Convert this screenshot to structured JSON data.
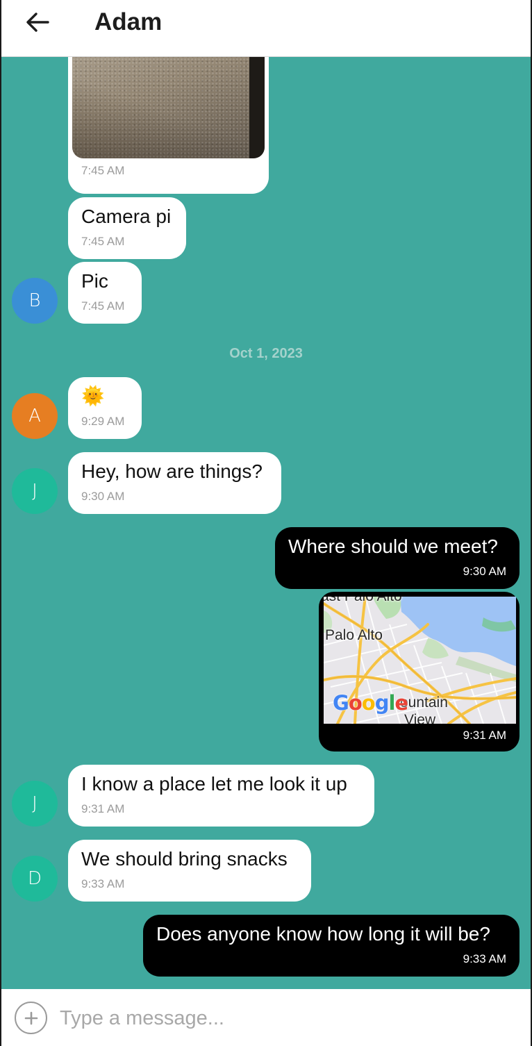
{
  "header": {
    "back_icon": "arrow-left-icon",
    "title": "Adam"
  },
  "colors": {
    "background": "#40a99e",
    "incoming_bubble": "#ffffff",
    "outgoing_bubble": "#000000",
    "avatar_blue": "#3a8fd6",
    "avatar_orange": "#e67e22",
    "avatar_teal": "#1fba9a"
  },
  "messages": [
    {
      "sender": "incoming",
      "type": "image",
      "time": "7:45 AM"
    },
    {
      "sender": "incoming",
      "type": "text",
      "text": "Camera pi",
      "time": "7:45 AM"
    },
    {
      "sender": "incoming",
      "type": "text",
      "avatar": "B",
      "text": "Pic",
      "time": "7:45 AM"
    },
    {
      "date_separator": "Oct 1, 2023"
    },
    {
      "sender": "incoming",
      "type": "emoji",
      "avatar": "A",
      "emoji": "🌞",
      "time": "9:29 AM"
    },
    {
      "sender": "incoming",
      "type": "text",
      "avatar": "J",
      "text": "Hey, how are things?",
      "time": "9:30 AM"
    },
    {
      "sender": "outgoing",
      "type": "text",
      "text": "Where should we meet?",
      "time": "9:30 AM"
    },
    {
      "sender": "outgoing",
      "type": "map",
      "labels": [
        "ast Palo Alto",
        "Palo Alto",
        "ountain",
        "View"
      ],
      "logo": "Google",
      "time": "9:31 AM"
    },
    {
      "sender": "incoming",
      "type": "text",
      "avatar": "J",
      "text": "I know a place let me look it up",
      "time": "9:31 AM"
    },
    {
      "sender": "incoming",
      "type": "text",
      "avatar": "D",
      "text": "We should bring snacks",
      "time": "9:33 AM"
    },
    {
      "sender": "outgoing",
      "type": "text",
      "text": "Does anyone know how long it will be?",
      "time": "9:33 AM"
    }
  ],
  "composer": {
    "add_icon": "plus-circle-icon",
    "placeholder": "Type a message..."
  }
}
